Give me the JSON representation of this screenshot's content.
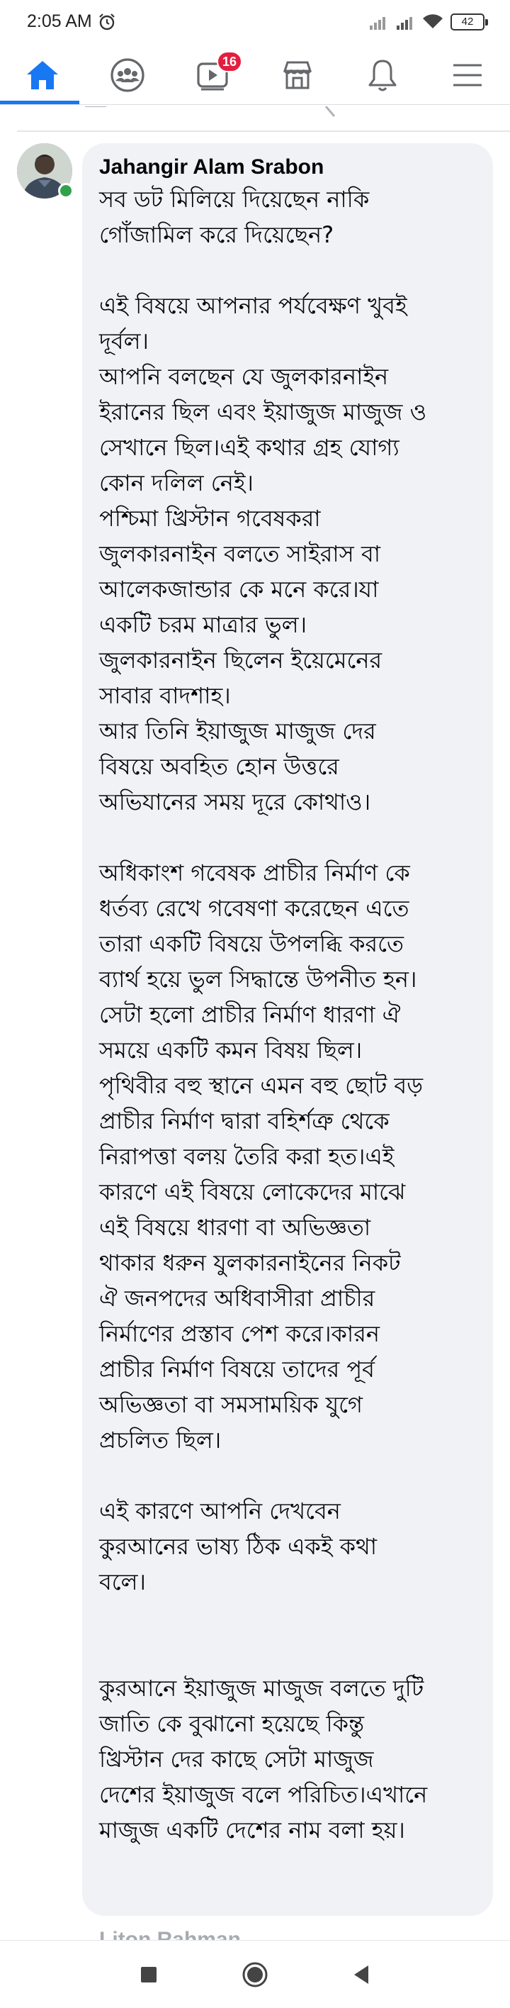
{
  "status_bar": {
    "time": "2:05 AM",
    "battery": "42"
  },
  "nav": {
    "items": [
      {
        "name": "home",
        "icon": "home-icon",
        "active": true
      },
      {
        "name": "groups",
        "icon": "groups-icon"
      },
      {
        "name": "watch",
        "icon": "video-icon",
        "badge": "16"
      },
      {
        "name": "marketplace",
        "icon": "store-icon"
      },
      {
        "name": "notifications",
        "icon": "bell-icon"
      },
      {
        "name": "menu",
        "icon": "hamburger-icon"
      }
    ],
    "accent": "#1877f2",
    "badge_color": "#e41e3f"
  },
  "comment": {
    "author": "Jahangir Alam Srabon",
    "paragraphs": [
      [
        "সব ডট মিলিয়ে দিয়েছেন নাকি",
        "গোঁজামিল করে দিয়েছেন?"
      ],
      [
        "এই বিষয়ে আপনার পর্যবেক্ষণ খুবই",
        "দূর্বল।",
        "আপনি বলছেন যে জুলকারনাইন",
        "ইরানের ছিল এবং ইয়াজুজ মাজুজ ও",
        "সেখানে ছিল।এই কথার গ্রহ যোগ্য",
        "কোন দলিল নেই।",
        "পশ্চিমা খ্রিস্টান গবেষকরা",
        "জুলকারনাইন বলতে সাইরাস বা",
        "আলেকজান্ডার কে মনে করে।যা",
        "একটি চরম মাত্রার ভুল।",
        "জুলকারনাইন  ছিলেন ইয়েমেনের",
        "সাবার বাদশাহ।",
        "আর তিনি ইয়াজুজ মাজুজ দের",
        "বিষয়ে অবহিত হোন উত্তরে",
        "অভিযানের সময় দূরে কোথাও।"
      ],
      [
        "অধিকাংশ গবেষক প্রাচীর নির্মাণ কে",
        "ধর্তব্য রেখে গবেষণা করেছেন এতে",
        "তারা একটি বিষয়ে উপলব্ধি করতে",
        "ব্যার্থ হয়ে ভুল সিদ্ধান্তে উপনীত হন।",
        "সেটা হলো প্রাচীর নির্মাণ ধারণা ঐ",
        "সময়ে একটি কমন বিষয় ছিল।",
        "পৃথিবীর বহু স্থানে এমন বহু ছোট বড়",
        "প্রাচীর নির্মাণ দ্বারা বহির্শত্রু থেকে",
        "নিরাপত্তা বলয় তৈরি করা হত।এই",
        "কারণে এই বিষয়ে লোকেদের মাঝে",
        "এই বিষয়ে ধারণা বা অভিজ্ঞতা",
        "থাকার ধরুন যুলকারনাইনের নিকট",
        "ঐ জনপদের অধিবাসীরা প্রাচীর",
        "নির্মাণের প্রস্তাব পেশ করে।কারন",
        "প্রাচীর নির্মাণ বিষয়ে তাদের পূর্ব",
        "অভিজ্ঞতা বা সমসাময়িক যুগে",
        "প্রচলিত ছিল।"
      ],
      [
        "এই কারণে আপনি দেখবেন",
        "কুরআনের ভাষ্য ঠিক একই কথা",
        "বলে।"
      ],
      [
        "কুরআনে ইয়াজুজ মাজুজ বলতে দুটি",
        "জাতি কে বুঝানো হয়েছে কিন্তু",
        "খ্রিস্টান দের কাছে সেটা মাজুজ",
        "দেশের ইয়াজুজ বলে পরিচিত।এখানে",
        "মাজুজ একটি দেশের নাম বলা হয়।"
      ]
    ]
  },
  "next_comment": {
    "author": "Liton Rahman"
  },
  "system_nav": {
    "buttons": [
      "recents-icon",
      "home-circle-icon",
      "back-icon"
    ]
  }
}
